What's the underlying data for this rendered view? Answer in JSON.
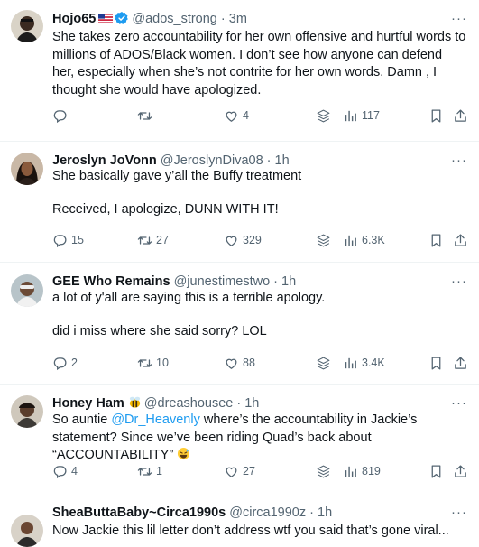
{
  "tweets": [
    {
      "name": "Hojo65",
      "handle": "@ados_strong",
      "time": "3m",
      "lines": [
        "She takes zero accountability for her own offensive and hurtful words to millions of ADOS/Black women. I don’t see how anyone can defend her, especially when she’s not contrite for her own words. Damn , I thought she would have apologized."
      ],
      "replies": "",
      "retweets": "",
      "likes": "4",
      "views": "117"
    },
    {
      "name": "Jeroslyn JoVonn",
      "handle": "@JeroslynDiva08",
      "time": "1h",
      "lines": [
        "She basically gave y’all the Buffy treatment",
        "Received, I apologize, DUNN WITH IT!"
      ],
      "replies": "15",
      "retweets": "27",
      "likes": "329",
      "views": "6.3K"
    },
    {
      "name": "GEE Who Remains",
      "handle": "@junestimestwo",
      "time": "1h",
      "lines": [
        "a lot of y'all are saying this is a terrible apology.",
        "did i miss where she said sorry? LOL"
      ],
      "replies": "2",
      "retweets": "10",
      "likes": "88",
      "views": "3.4K"
    },
    {
      "name": "Honey Ham",
      "handle": "@dreashousee",
      "time": "1h",
      "text_before_mention": "So auntie ",
      "mention": "@Dr_Heavenly",
      "text_after_mention": " where’s the accountability in Jackie’s statement? Since we’ve been riding Quad’s back about “ACCOUNTABILITY”",
      "replies": "4",
      "retweets": "1",
      "likes": "27",
      "views": "819"
    },
    {
      "name": "SheaButtaBaby~Circa1990s",
      "handle": "@circa1990z",
      "time": "1h",
      "lines": [
        "Now Jackie this lil letter don’t address wtf you said that’s gone viral..."
      ]
    }
  ],
  "colors": {
    "text": "#0f1419",
    "secondary": "#536471",
    "link": "#1d9bf0",
    "verified": "#1d9bf0",
    "divider": "#eff3f4"
  },
  "icons": {
    "reply": "reply-icon",
    "retweet": "retweet-icon",
    "like": "heart-icon",
    "stack": "layers-icon",
    "views": "views-bars-icon",
    "bookmark": "bookmark-icon",
    "share": "share-icon",
    "more": "more-dots-icon",
    "verified": "verified-badge-icon",
    "flag": "us-flag-emoji",
    "bee": "bee-emoji",
    "laugh": "sweat-smile-emoji"
  }
}
